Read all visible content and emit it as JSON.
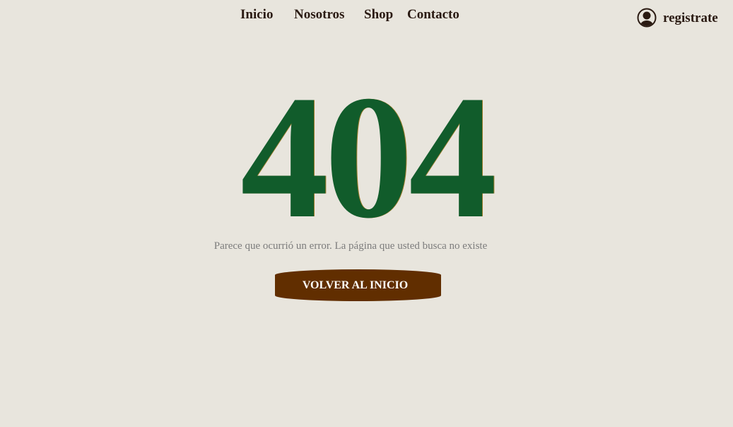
{
  "nav": {
    "items": [
      {
        "label": "Inicio"
      },
      {
        "label": "Nosotros"
      },
      {
        "label": "Shop"
      },
      {
        "label": "Contacto"
      }
    ]
  },
  "account": {
    "register_label": "registrate",
    "icon": "user-avatar-icon"
  },
  "error": {
    "code": "404",
    "message": "Parece que ocurrió un error. La página que usted busca no existe",
    "button_label": "VOLVER AL INICIO"
  },
  "colors": {
    "background": "#e8e5dd",
    "code_green": "#115c2b",
    "button_brown": "#612e00",
    "nav_text": "#2a1a12",
    "message_gray": "#7c7c7c"
  }
}
